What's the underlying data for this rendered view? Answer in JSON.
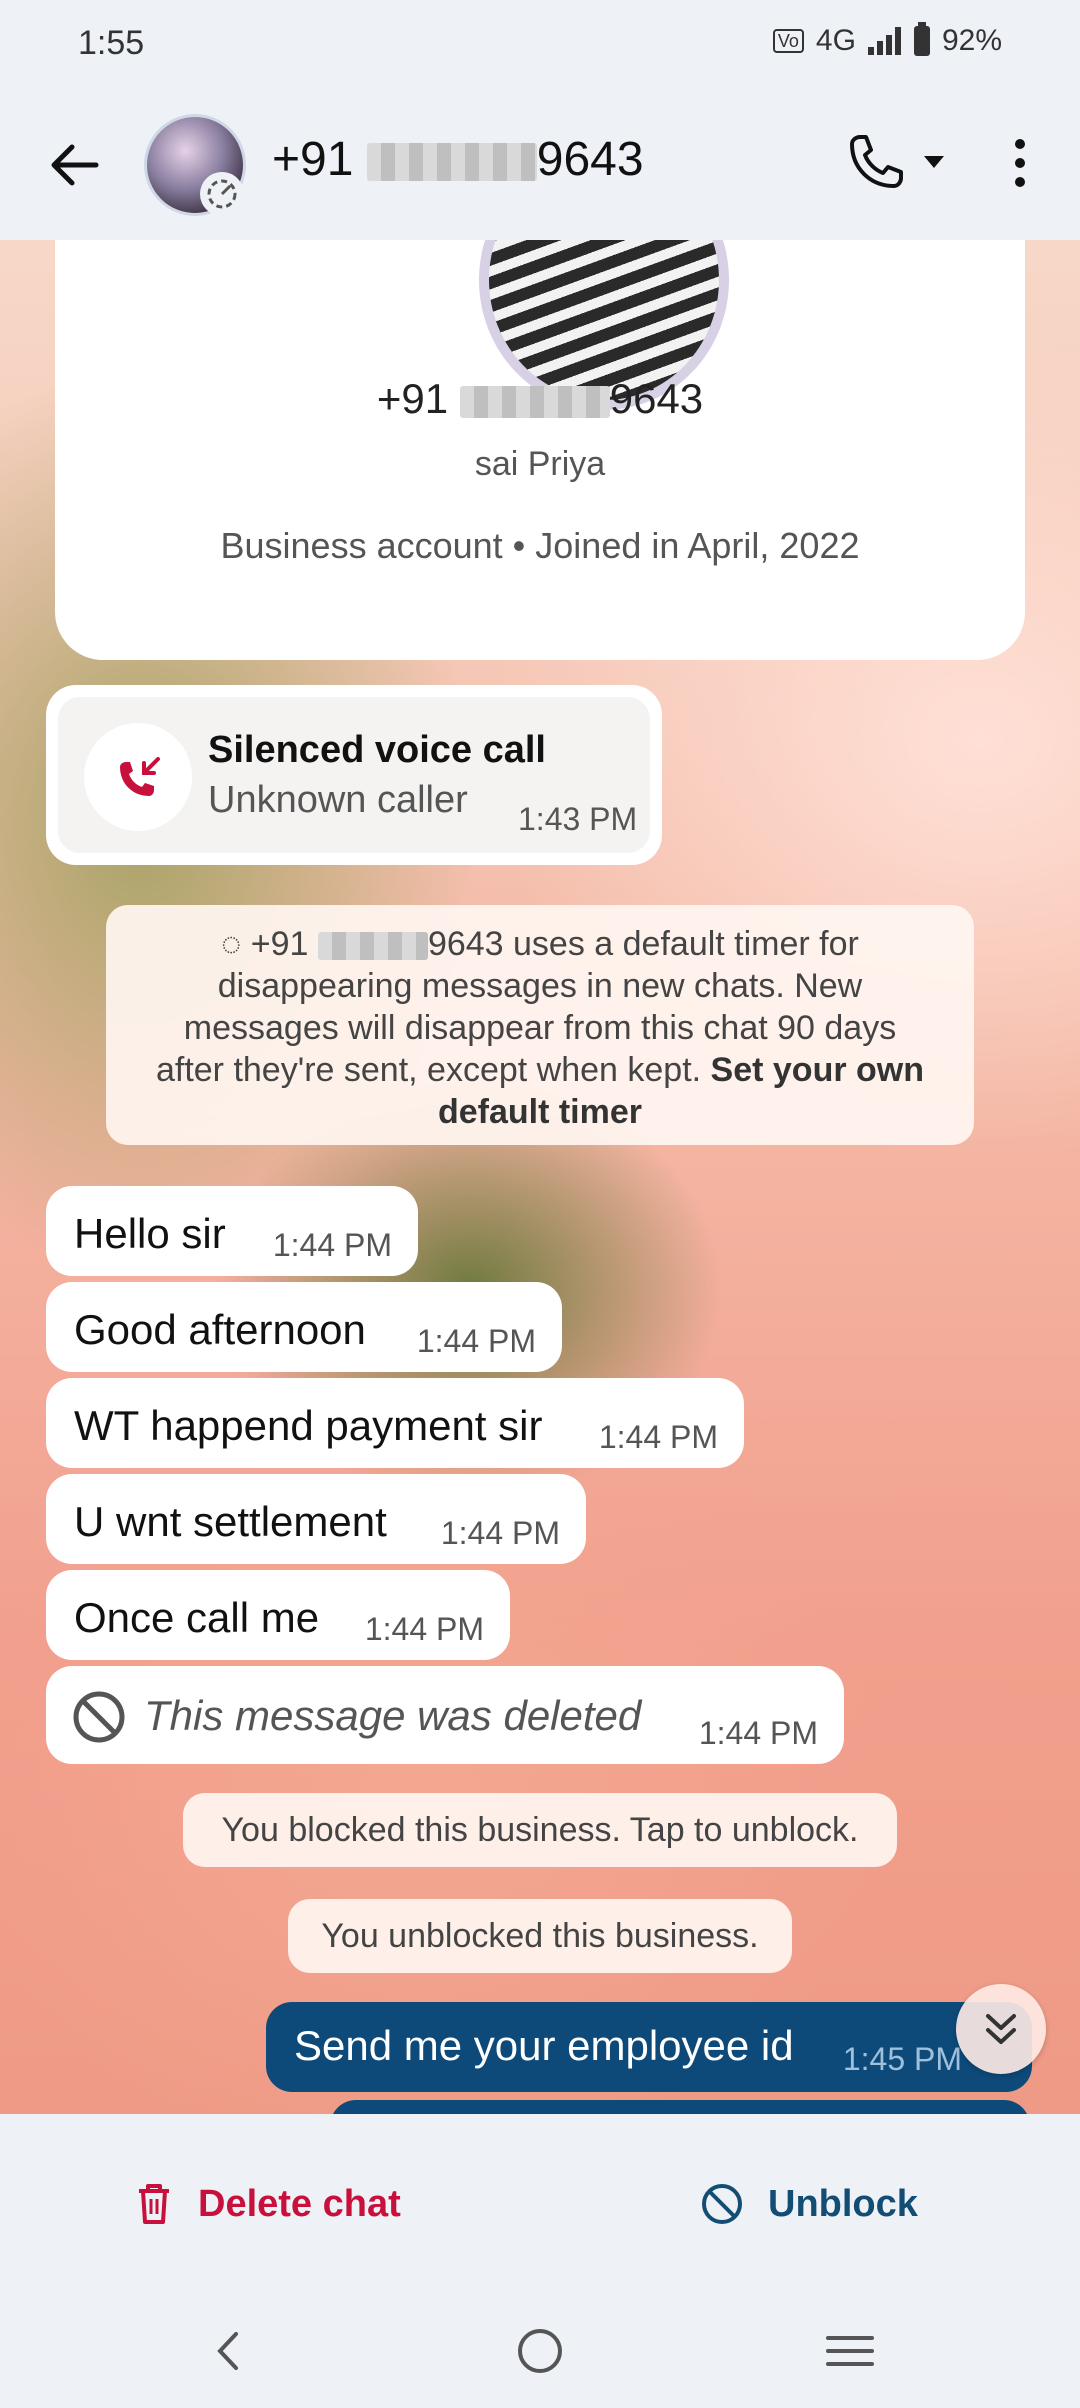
{
  "status_bar": {
    "time": "1:55",
    "network": "4G",
    "volte": "VoLTE",
    "battery": "92%"
  },
  "header": {
    "title_prefix": "+91",
    "title_suffix": "9643",
    "call_menu": "voice-call-dropdown",
    "more": "more-options"
  },
  "profile_card": {
    "phone_prefix": "+91",
    "phone_suffix": "9643",
    "name": "sai Priya",
    "info": "Business account • Joined in April, 2022"
  },
  "call_log": {
    "title": "Silenced voice call",
    "subtitle": "Unknown caller",
    "time": "1:43 PM"
  },
  "timer_notice": {
    "prefix": "+91",
    "suffix": "9643",
    "text": " uses a default timer for disappearing messages in new chats. New messages will disappear from this chat 90 days after they're sent, except when kept. ",
    "link": "Set your own default timer"
  },
  "messages": [
    {
      "text": "Hello sir",
      "time": "1:44 PM"
    },
    {
      "text": "Good afternoon",
      "time": "1:44 PM"
    },
    {
      "text": "WT happend payment sir",
      "time": "1:44 PM"
    },
    {
      "text": "U wnt settlement",
      "time": "1:44 PM"
    },
    {
      "text": "Once call me",
      "time": "1:44 PM"
    },
    {
      "text": "This message was deleted",
      "time": "1:44 PM"
    }
  ],
  "system": {
    "blocked": "You blocked this business. Tap to unblock.",
    "unblocked": "You unblocked this business."
  },
  "outgoing": [
    {
      "text": "Send me your employee id",
      "time": "1:45 PM"
    }
  ],
  "actions": {
    "delete": "Delete chat",
    "unblock": "Unblock"
  },
  "colors": {
    "accent": "#0d4a7a",
    "danger": "#c8103c",
    "unblock": "#134d74"
  }
}
